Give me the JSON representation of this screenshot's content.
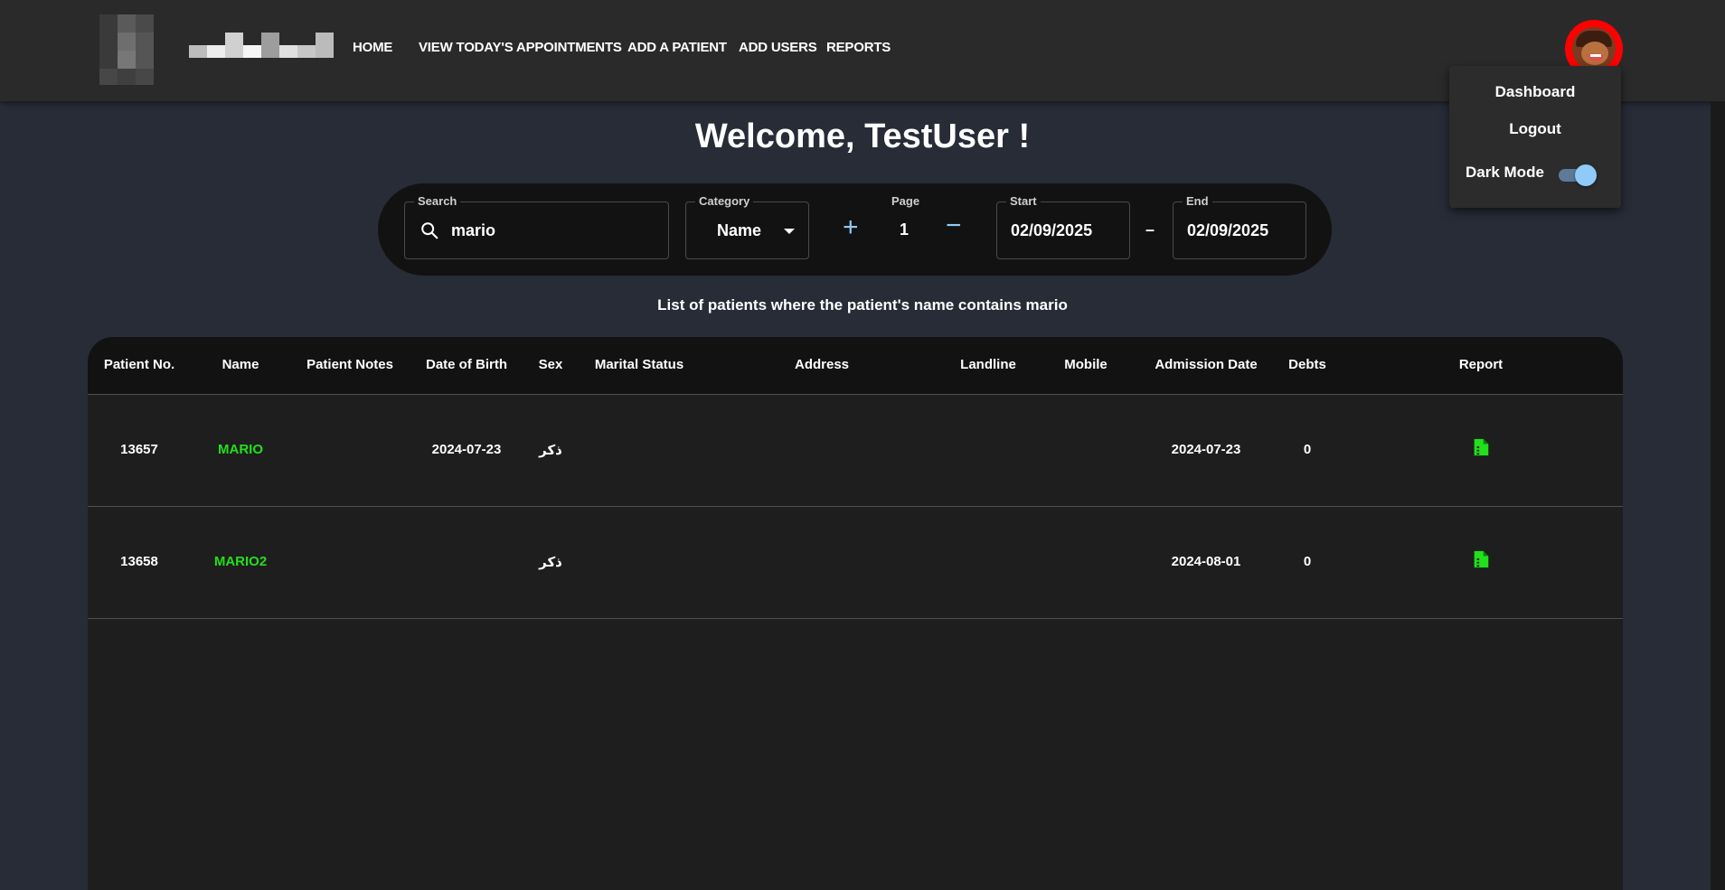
{
  "nav": {
    "links": [
      "HOME",
      "VIEW TODAY'S APPOINTMENTS",
      "ADD A PATIENT",
      "ADD USERS",
      "REPORTS"
    ]
  },
  "user_menu": {
    "dashboard_label": "Dashboard",
    "logout_label": "Logout",
    "dark_mode_label": "Dark Mode",
    "dark_mode_on": true
  },
  "welcome": "Welcome, TestUser !",
  "filters": {
    "search_label": "Search",
    "search_value": "mario",
    "category_label": "Category",
    "category_value": "Name",
    "page_label": "Page",
    "page_value": "1",
    "plus_label": "+",
    "minus_label": "−",
    "start_label": "Start",
    "start_value": "02/09/2025",
    "range_separator": "–",
    "end_label": "End",
    "end_value": "02/09/2025"
  },
  "list_title": "List of patients where the patient's name contains mario",
  "table": {
    "columns": [
      "Patient No.",
      "Name",
      "Patient Notes",
      "Date of Birth",
      "Sex",
      "Marital Status",
      "Address",
      "Landline",
      "Mobile",
      "Admission Date",
      "Debts",
      "Report"
    ],
    "rows": [
      {
        "no": "13657",
        "name": "MARIO",
        "notes": "",
        "dob": "2024-07-23",
        "sex": "ذكر",
        "marital": "",
        "address": "",
        "landline": "",
        "mobile": "",
        "admission": "2024-07-23",
        "debts": "0"
      },
      {
        "no": "13658",
        "name": "MARIO2",
        "notes": "",
        "dob": "",
        "sex": "ذكر",
        "marital": "",
        "address": "",
        "landline": "",
        "mobile": "",
        "admission": "2024-08-01",
        "debts": "0"
      }
    ]
  },
  "colors": {
    "accent": "#90caf9",
    "name_green": "#22e01b",
    "avatar_ring": "#ff0000",
    "background": "#272c37"
  }
}
